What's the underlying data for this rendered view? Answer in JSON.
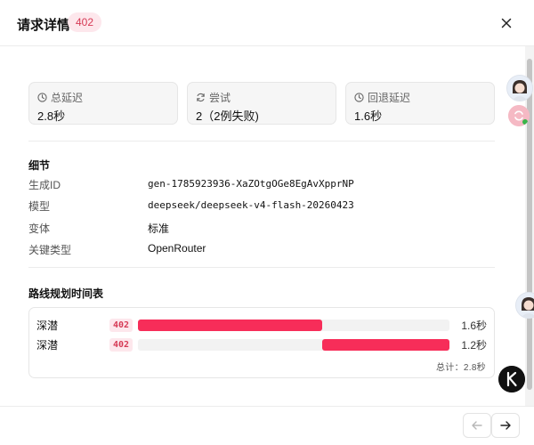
{
  "header": {
    "title": "请求详情",
    "status_code": "402"
  },
  "stats": [
    {
      "icon": "clock-icon",
      "label": "总延迟",
      "value": "2.8秒"
    },
    {
      "icon": "refresh-icon",
      "label": "尝试",
      "value": "2（2例失败)"
    },
    {
      "icon": "clock-icon",
      "label": "回退延迟",
      "value": "1.6秒"
    }
  ],
  "details": {
    "title": "细节",
    "rows": [
      {
        "label": "生成ID",
        "value": "gen-1785923936-XaZOtgOGe8EgAvXpprNP"
      },
      {
        "label": "模型",
        "value": "deepseek/deepseek-v4-flash-20260423"
      },
      {
        "label": "变体",
        "value": "标准"
      },
      {
        "label": "关键类型",
        "value": "OpenRouter"
      }
    ]
  },
  "timeline": {
    "title": "路线规划时间表",
    "rows": [
      {
        "name": "深潜",
        "code": "402",
        "start": 0.0,
        "fraction": 0.59,
        "duration": "1.6秒"
      },
      {
        "name": "深潜",
        "code": "402",
        "start": 0.59,
        "fraction": 0.41,
        "duration": "1.2秒"
      }
    ],
    "total": "总计：2.8秒"
  },
  "colors": {
    "accent": "#f72d59",
    "chip_bg": "#fde7ec",
    "chip_text": "#d63a55"
  }
}
